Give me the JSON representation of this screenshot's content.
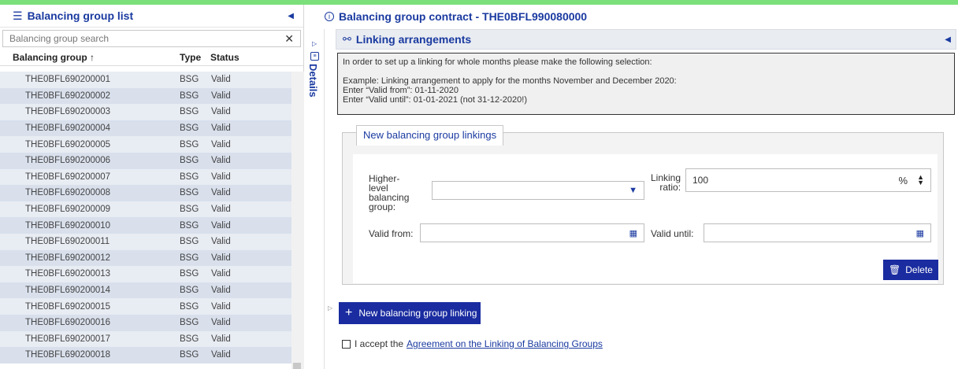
{
  "left_panel": {
    "title": "Balancing group list",
    "search_placeholder": "Balancing group search",
    "columns": [
      "Balancing group",
      "Type",
      "Status"
    ],
    "sort_indicator": "↑",
    "rows": [
      {
        "group": "THE0BFL690200001",
        "type": "BSG",
        "status": "Valid"
      },
      {
        "group": "THE0BFL690200002",
        "type": "BSG",
        "status": "Valid"
      },
      {
        "group": "THE0BFL690200003",
        "type": "BSG",
        "status": "Valid"
      },
      {
        "group": "THE0BFL690200004",
        "type": "BSG",
        "status": "Valid"
      },
      {
        "group": "THE0BFL690200005",
        "type": "BSG",
        "status": "Valid"
      },
      {
        "group": "THE0BFL690200006",
        "type": "BSG",
        "status": "Valid"
      },
      {
        "group": "THE0BFL690200007",
        "type": "BSG",
        "status": "Valid"
      },
      {
        "group": "THE0BFL690200008",
        "type": "BSG",
        "status": "Valid"
      },
      {
        "group": "THE0BFL690200009",
        "type": "BSG",
        "status": "Valid"
      },
      {
        "group": "THE0BFL690200010",
        "type": "BSG",
        "status": "Valid"
      },
      {
        "group": "THE0BFL690200011",
        "type": "BSG",
        "status": "Valid"
      },
      {
        "group": "THE0BFL690200012",
        "type": "BSG",
        "status": "Valid"
      },
      {
        "group": "THE0BFL690200013",
        "type": "BSG",
        "status": "Valid"
      },
      {
        "group": "THE0BFL690200014",
        "type": "BSG",
        "status": "Valid"
      },
      {
        "group": "THE0BFL690200015",
        "type": "BSG",
        "status": "Valid"
      },
      {
        "group": "THE0BFL690200016",
        "type": "BSG",
        "status": "Valid"
      },
      {
        "group": "THE0BFL690200017",
        "type": "BSG",
        "status": "Valid"
      },
      {
        "group": "THE0BFL690200018",
        "type": "BSG",
        "status": "Valid"
      }
    ]
  },
  "details_strip": {
    "label": "Details"
  },
  "contract": {
    "title": "Balancing group contract - THE0BFL990080000",
    "section_title": "Linking arrangements",
    "note": [
      "In order to set up a linking for whole months please make the following selection:",
      "Example: Linking arrangement to apply for the months November and December 2020:",
      "Enter “Valid from”: 01-11-2020",
      "Enter “Valid until”: 01-01-2021 (not 31-12-2020!)"
    ],
    "fieldset_legend": "New balancing group linkings",
    "higher_level_label": [
      "Higher-",
      "level",
      "balancing",
      "group:"
    ],
    "linking_ratio_label": [
      "Linking",
      "ratio:"
    ],
    "linking_ratio_value": "100",
    "percent_symbol": "%",
    "valid_from_label": "Valid from:",
    "valid_until_label": "Valid until:",
    "delete_label": "Delete",
    "new_linking_label": "New balancing group linking",
    "accept_prefix": "I accept the",
    "accept_link": "Agreement on the Linking of Balancing Groups"
  },
  "colors": {
    "accent": "#1a3aa0",
    "button": "#1a2ca0",
    "top_bar": "#7be07b"
  }
}
